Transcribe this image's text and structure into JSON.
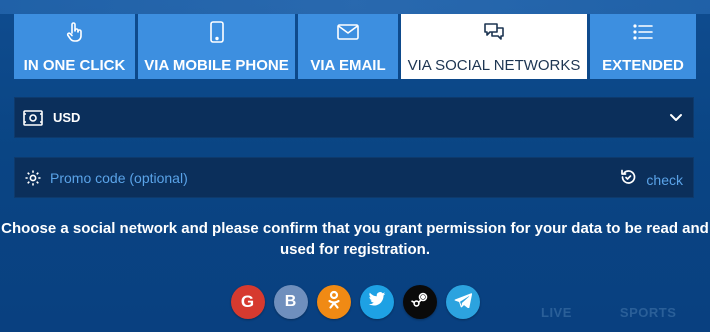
{
  "tabs": [
    {
      "label": "IN ONE CLICK",
      "icon": "pointer-hand-icon",
      "active": false
    },
    {
      "label": "VIA MOBILE PHONE",
      "icon": "mobile-phone-icon",
      "active": false
    },
    {
      "label": "VIA EMAIL",
      "icon": "envelope-icon",
      "active": false
    },
    {
      "label": "VIA SOCIAL NETWORKS",
      "icon": "chat-bubbles-icon",
      "active": true
    },
    {
      "label": "EXTENDED",
      "icon": "list-icon",
      "active": false
    }
  ],
  "currency": {
    "value": "USD",
    "icon": "banknote-icon"
  },
  "promo": {
    "placeholder": "Promo code (optional)",
    "check_label": "check"
  },
  "info_text": "Choose a social network and please confirm that you grant permission for your data to be read and used for registration.",
  "socials": [
    {
      "name": "Google",
      "glyph": "G",
      "color": "#d63a2f"
    },
    {
      "name": "VK",
      "glyph": "B",
      "color": "#6f8fbd"
    },
    {
      "name": "Odnoklassniki",
      "glyph": "ok",
      "color": "#f08a14"
    },
    {
      "name": "Twitter",
      "glyph": "bird",
      "color": "#1ea1e4"
    },
    {
      "name": "Steam",
      "glyph": "steam",
      "color": "#0a0a0a"
    },
    {
      "name": "Telegram",
      "glyph": "plane",
      "color": "#2ca3df"
    }
  ],
  "bottom_nav": [
    "LIVE",
    "SPORTS"
  ],
  "colors": {
    "tab_bg": "#3d8fe0",
    "tab_active_bg": "#ffffff",
    "field_bg": "#0b2f5b",
    "link": "#5aa3e8"
  }
}
